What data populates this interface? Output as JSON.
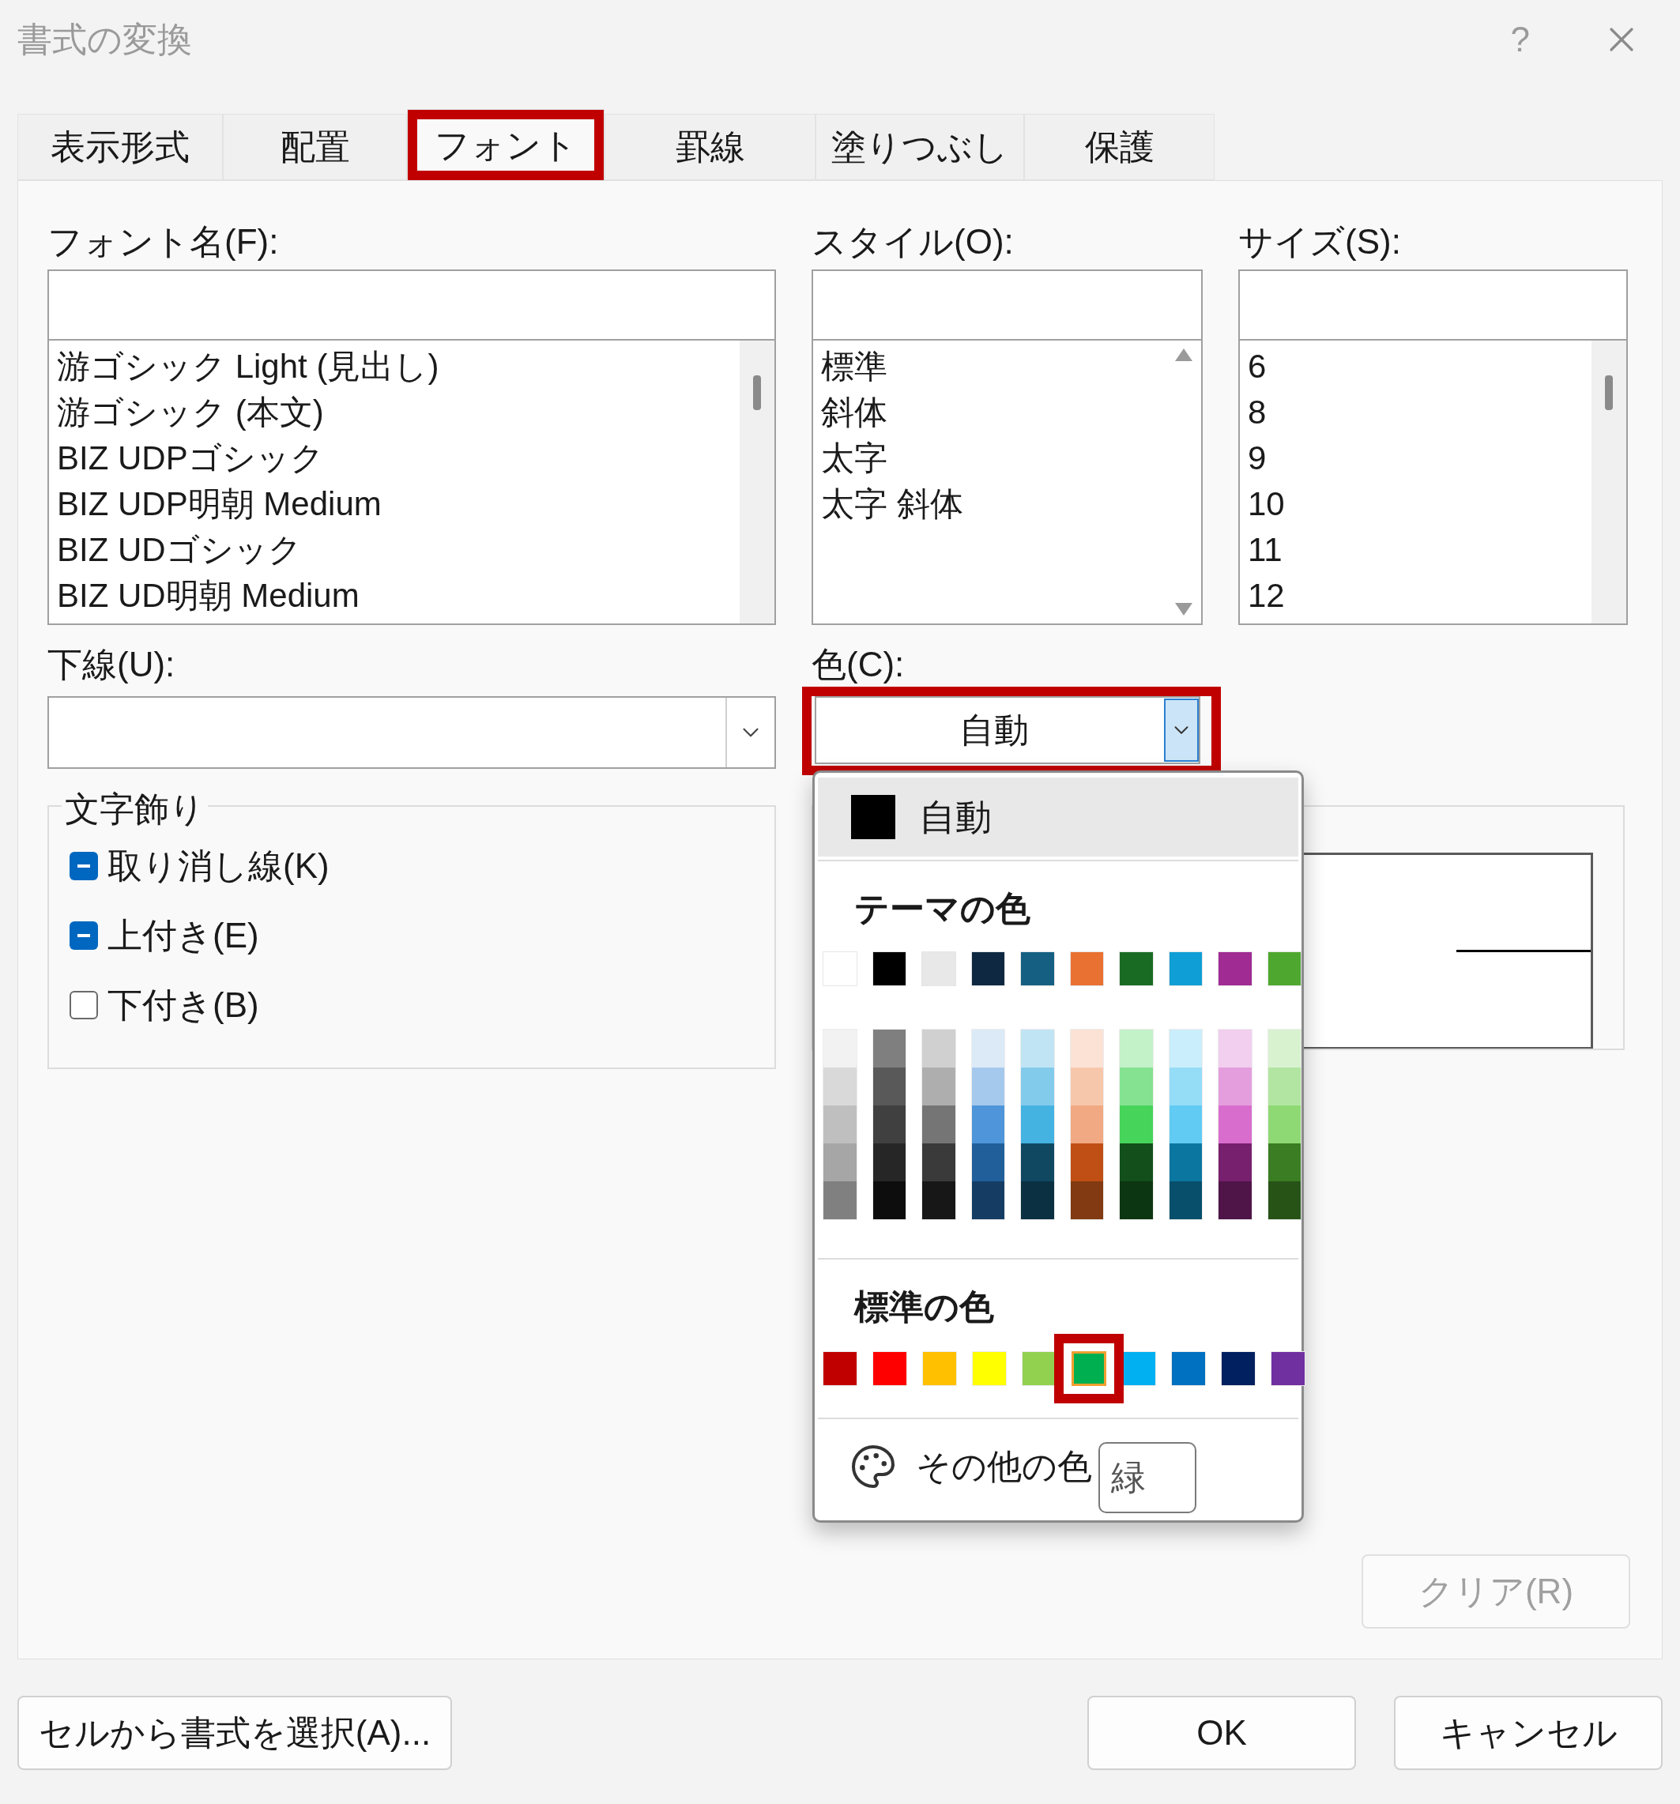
{
  "window": {
    "title": "書式の変換",
    "help_button": "?"
  },
  "tabs": [
    {
      "label": "表示形式",
      "selected": false,
      "annotated": false
    },
    {
      "label": "配置",
      "selected": false,
      "annotated": false
    },
    {
      "label": "フォント",
      "selected": true,
      "annotated": true
    },
    {
      "label": "罫線",
      "selected": false,
      "annotated": false
    },
    {
      "label": "塗りつぶし",
      "selected": false,
      "annotated": false
    },
    {
      "label": "保護",
      "selected": false,
      "annotated": false
    }
  ],
  "font_name": {
    "label": "フォント名(F):",
    "items": [
      "游ゴシック Light (見出し)",
      "游ゴシック (本文)",
      "BIZ UDPゴシック",
      "BIZ UDP明朝 Medium",
      "BIZ UDゴシック",
      "BIZ UD明朝 Medium"
    ]
  },
  "style": {
    "label": "スタイル(O):",
    "items": [
      "標準",
      "斜体",
      "太字",
      "太字 斜体"
    ]
  },
  "size": {
    "label": "サイズ(S):",
    "items": [
      "6",
      "8",
      "9",
      "10",
      "11",
      "12"
    ]
  },
  "underline": {
    "label": "下線(U):"
  },
  "color": {
    "label": "色(C):",
    "value": "自動",
    "annotated": true
  },
  "effects": {
    "title": "文字飾り",
    "options": [
      {
        "label": "取り消し線(K)",
        "mixed": true
      },
      {
        "label": "上付き(E)",
        "mixed": true
      },
      {
        "label": "下付き(B)",
        "mixed": false
      }
    ]
  },
  "color_menu": {
    "automatic": {
      "label": "自動",
      "color": "#000000"
    },
    "theme_heading": "テーマの色",
    "theme_colors": [
      {
        "color": "#ffffff",
        "shades": [
          {
            "color": "#f2f2f2"
          },
          {
            "color": "#d9d9d9"
          },
          {
            "color": "#bfbfbf"
          },
          {
            "color": "#a6a6a6"
          },
          {
            "color": "#808080"
          }
        ]
      },
      {
        "color": "#000000",
        "shades": [
          {
            "color": "#7f7f7f"
          },
          {
            "color": "#595959"
          },
          {
            "color": "#404040"
          },
          {
            "color": "#262626"
          },
          {
            "color": "#0d0d0d"
          }
        ]
      },
      {
        "color": "#e8e8e8",
        "shades": [
          {
            "color": "#d0d0d0"
          },
          {
            "color": "#aeaeae"
          },
          {
            "color": "#757575"
          },
          {
            "color": "#3a3a3a"
          },
          {
            "color": "#171717"
          }
        ]
      },
      {
        "color": "#0e2841",
        "shades": [
          {
            "color": "#dceaf7"
          },
          {
            "color": "#a5c8ed"
          },
          {
            "color": "#4e95d9"
          },
          {
            "color": "#215f9a"
          },
          {
            "color": "#153d64"
          }
        ]
      },
      {
        "color": "#156082",
        "shades": [
          {
            "color": "#c1e4f5"
          },
          {
            "color": "#83cbeb"
          },
          {
            "color": "#44b3e1"
          },
          {
            "color": "#104862"
          },
          {
            "color": "#0b3041"
          }
        ]
      },
      {
        "color": "#e97132",
        "shades": [
          {
            "color": "#fbe2d5"
          },
          {
            "color": "#f7c7ac"
          },
          {
            "color": "#f1a983"
          },
          {
            "color": "#c04f15"
          },
          {
            "color": "#813a11"
          }
        ]
      },
      {
        "color": "#196b24",
        "shades": [
          {
            "color": "#c3f1c8"
          },
          {
            "color": "#84e291"
          },
          {
            "color": "#47d45a"
          },
          {
            "color": "#124f1a"
          },
          {
            "color": "#0c3512"
          }
        ]
      },
      {
        "color": "#0f9ed5",
        "shades": [
          {
            "color": "#caeefb"
          },
          {
            "color": "#95dcf7"
          },
          {
            "color": "#61cbf3"
          },
          {
            "color": "#0b76a0"
          },
          {
            "color": "#074f6a"
          }
        ]
      },
      {
        "color": "#a02b93",
        "shades": [
          {
            "color": "#f2ceef"
          },
          {
            "color": "#e49edd"
          },
          {
            "color": "#d86dcd"
          },
          {
            "color": "#77206d"
          },
          {
            "color": "#4f1548"
          }
        ]
      },
      {
        "color": "#4ea72e",
        "shades": [
          {
            "color": "#d8f2d0"
          },
          {
            "color": "#b2e5a1"
          },
          {
            "color": "#8ed973"
          },
          {
            "color": "#3a7d22"
          },
          {
            "color": "#275317"
          }
        ]
      }
    ],
    "standard_heading": "標準の色",
    "standard_colors": [
      {
        "color": "#c00000",
        "selected": false,
        "annotated": false
      },
      {
        "color": "#ff0000",
        "selected": false,
        "annotated": false
      },
      {
        "color": "#ffc000",
        "selected": false,
        "annotated": false
      },
      {
        "color": "#ffff00",
        "selected": false,
        "annotated": false
      },
      {
        "color": "#92d050",
        "selected": false,
        "annotated": false
      },
      {
        "color": "#00b050",
        "selected": true,
        "annotated": true
      },
      {
        "color": "#00b0f0",
        "selected": false,
        "annotated": false
      },
      {
        "color": "#0070c0",
        "selected": false,
        "annotated": false
      },
      {
        "color": "#002060",
        "selected": false,
        "annotated": false
      },
      {
        "color": "#7030a0",
        "selected": false,
        "annotated": false
      }
    ],
    "more_colors": "その他の色",
    "tooltip": "緑"
  },
  "clear_button": {
    "label": "クリア(R)",
    "disabled": true
  },
  "buttons": {
    "pick_from_cell": "セルから書式を選択(A)...",
    "ok": "OK",
    "cancel": "キャンセル"
  }
}
